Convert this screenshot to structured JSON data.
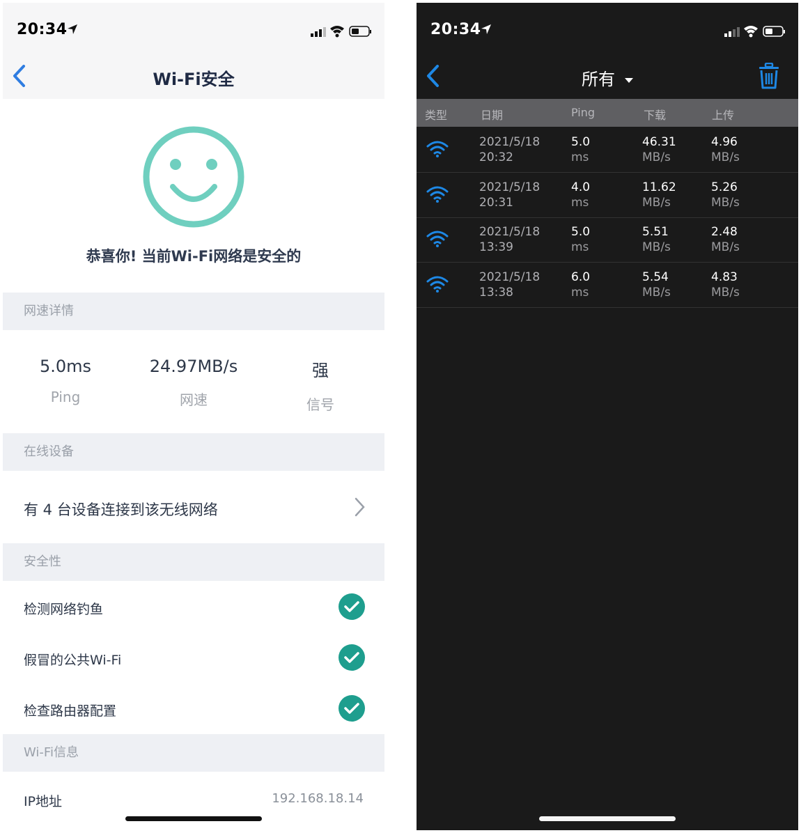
{
  "left": {
    "status_time": "20:34",
    "nav_title": "Wi-Fi安全",
    "congrats": "恭喜你! 当前Wi-Fi网络是安全的",
    "speed_section": "网速详情",
    "stats": [
      {
        "value": "5.0ms",
        "label": "Ping"
      },
      {
        "value": "24.97MB/s",
        "label": "网速"
      },
      {
        "value": "强",
        "label": "信号"
      }
    ],
    "devices_section": "在线设备",
    "devices_text": "有 4 台设备连接到该无线网络",
    "security_section": "安全性",
    "security_items": [
      {
        "label": "检测网络钓鱼",
        "passed": true
      },
      {
        "label": "假冒的公共Wi-Fi",
        "passed": true
      },
      {
        "label": "检查路由器配置",
        "passed": true
      }
    ],
    "wifi_section": "Wi-Fi信息",
    "ip_label": "IP地址",
    "ip_value": "192.168.18.14",
    "colors": {
      "accent": "#1e9e8e",
      "smiley": "#6fcfbf",
      "back": "#2f7de1"
    }
  },
  "right": {
    "status_time": "20:34",
    "filter": "所有",
    "headers": [
      "类型",
      "日期",
      "Ping",
      "下载",
      "上传"
    ],
    "rows": [
      {
        "date": "2021/5/18",
        "time": "20:32",
        "ping": "5.0",
        "ping_unit": "ms",
        "down": "46.31",
        "down_unit": "MB/s",
        "up": "4.96",
        "up_unit": "MB/s"
      },
      {
        "date": "2021/5/18",
        "time": "20:31",
        "ping": "4.0",
        "ping_unit": "ms",
        "down": "11.62",
        "down_unit": "MB/s",
        "up": "5.26",
        "up_unit": "MB/s"
      },
      {
        "date": "2021/5/18",
        "time": "13:39",
        "ping": "5.0",
        "ping_unit": "ms",
        "down": "5.51",
        "down_unit": "MB/s",
        "up": "2.48",
        "up_unit": "MB/s"
      },
      {
        "date": "2021/5/18",
        "time": "13:38",
        "ping": "6.0",
        "ping_unit": "ms",
        "down": "5.54",
        "down_unit": "MB/s",
        "up": "4.83",
        "up_unit": "MB/s"
      }
    ],
    "colors": {
      "accent": "#1e88e5",
      "background": "#1a1a1a"
    }
  }
}
